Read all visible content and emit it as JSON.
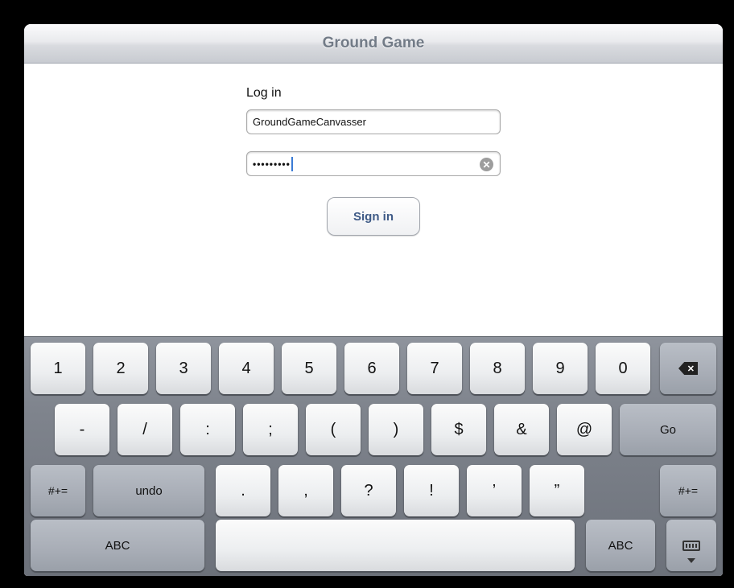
{
  "navbar": {
    "title": "Ground Game"
  },
  "login": {
    "label": "Log in",
    "username_value": "GroundGameCanvasser",
    "password_masked": "•••••••••",
    "clear_glyph": "✕",
    "signin_label": "Sign in"
  },
  "keyboard": {
    "row1": [
      "1",
      "2",
      "3",
      "4",
      "5",
      "6",
      "7",
      "8",
      "9",
      "0"
    ],
    "row2": [
      "-",
      "/",
      ":",
      ";",
      "(",
      ")",
      "$",
      "&",
      "@"
    ],
    "row2_go": "Go",
    "row3_left": "#+=",
    "row3_undo": "undo",
    "row3": [
      ".",
      ",",
      "?",
      "!",
      "’",
      "”"
    ],
    "row3_right": "#+=",
    "row4_abc_left": "ABC",
    "row4_abc_right": "ABC",
    "backspace_glyph": "✕"
  },
  "icons": {
    "backspace": "backspace-icon",
    "dismiss_keyboard": "keyboard-dismiss-icon",
    "clear": "clear-text-icon"
  }
}
